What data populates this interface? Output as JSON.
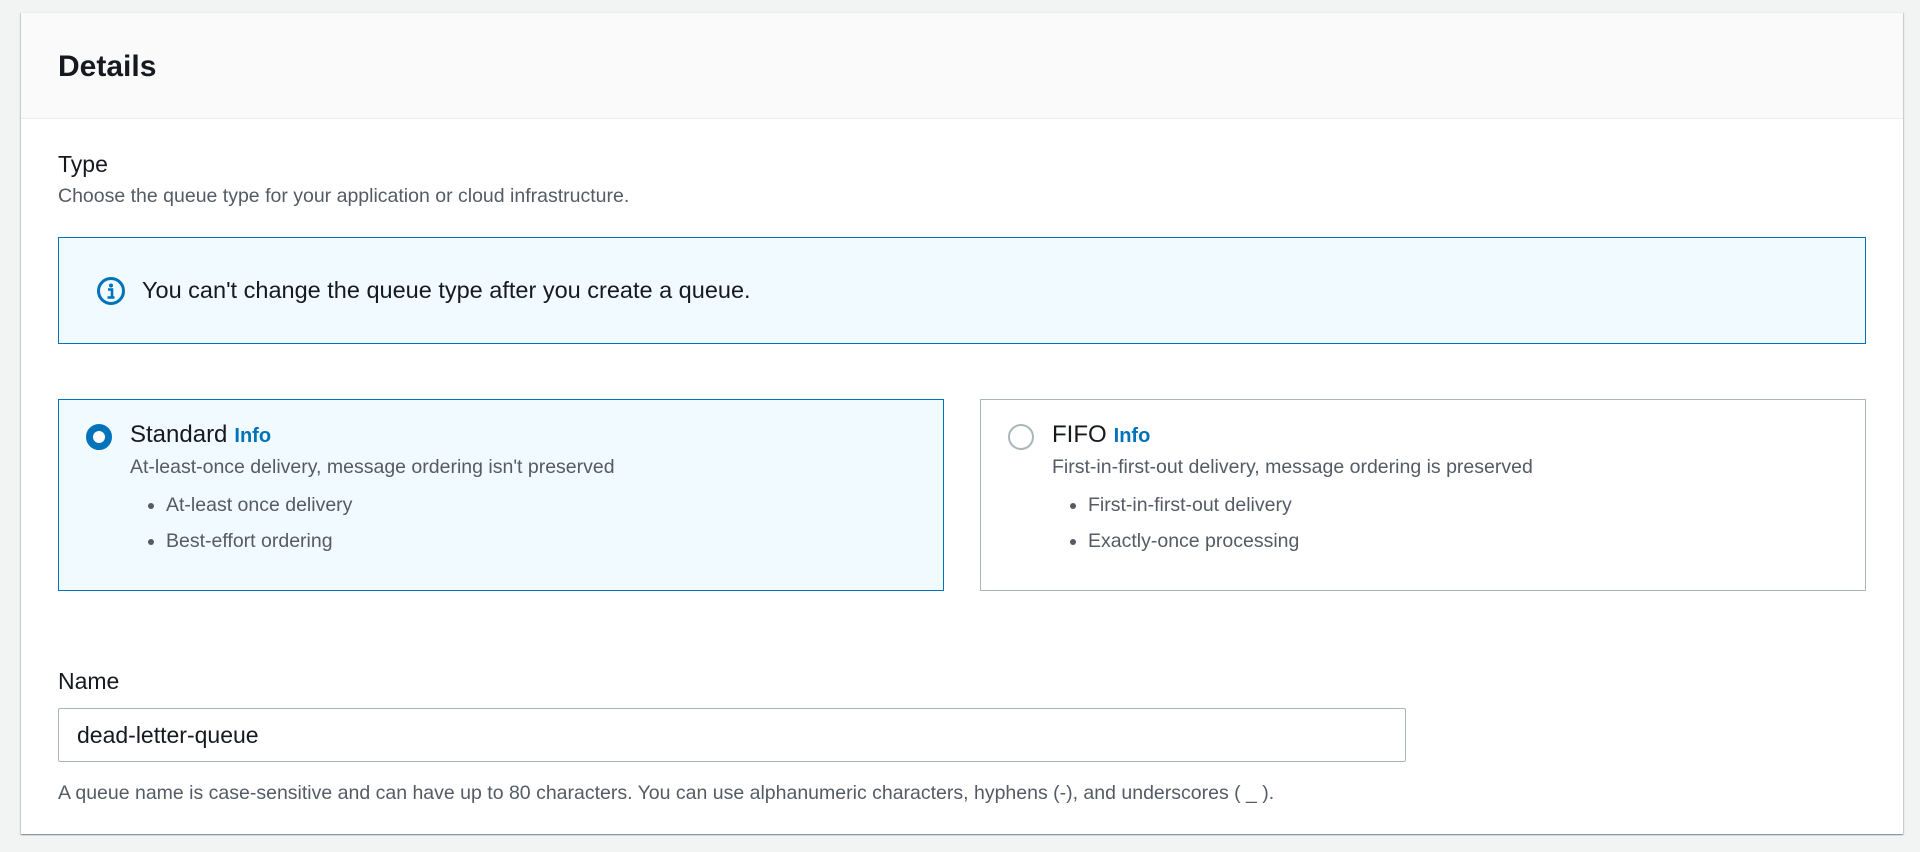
{
  "panel": {
    "title": "Details"
  },
  "type_section": {
    "label": "Type",
    "description": "Choose the queue type for your application or cloud infrastructure."
  },
  "alert": {
    "icon": "info-circle-icon",
    "text": "You can't change the queue type after you create a queue."
  },
  "queue_types": {
    "standard": {
      "title": "Standard",
      "info_label": "Info",
      "description": "At-least-once delivery, message ordering isn't preserved",
      "features": [
        "At-least once delivery",
        "Best-effort ordering"
      ],
      "selected": true
    },
    "fifo": {
      "title": "FIFO",
      "info_label": "Info",
      "description": "First-in-first-out delivery, message ordering is preserved",
      "features": [
        "First-in-first-out delivery",
        "Exactly-once processing"
      ],
      "selected": false
    }
  },
  "name_field": {
    "label": "Name",
    "value": "dead-letter-queue",
    "help_text": "A queue name is case-sensitive and can have up to 80 characters. You can use alphanumeric characters, hyphens (-), and underscores ( _ )."
  },
  "colors": {
    "accent": "#0073bb",
    "selected_background": "#f1faff",
    "border": "#aab7b8",
    "text_primary": "#16191f",
    "text_secondary": "#545b64"
  }
}
